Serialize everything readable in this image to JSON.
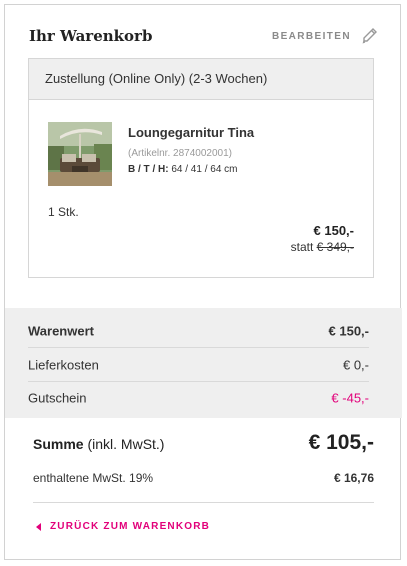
{
  "cart": {
    "title": "Ihr Warenkorb",
    "edit_label": "BEARBEITEN"
  },
  "delivery": {
    "heading": "Zustellung (Online Only) (2-3 Wochen)",
    "item": {
      "name": "Loungegarnitur Tina",
      "article_no": "(Artikelnr. 2874002001)",
      "dim_label": "B / T / H:",
      "dim_value": "64 / 41 / 64 cm",
      "quantity": "1 Stk.",
      "price": "€ 150,-",
      "was_prefix": "statt",
      "was_price": "€ 349,-"
    }
  },
  "summary": {
    "rows": [
      {
        "label": "Warenwert",
        "value": "€ 150,-"
      },
      {
        "label": "Lieferkosten",
        "value": "€ 0,-"
      },
      {
        "label": "Gutschein",
        "value": "€ -45,-"
      }
    ],
    "total_label": "Summe",
    "total_suffix": "(inkl. MwSt.)",
    "total_value": "€ 105,-",
    "tax_label": "enthaltene MwSt. 19%",
    "tax_value": "€ 16,76"
  },
  "back_link": "ZURÜCK ZUM WARENKORB",
  "colors": {
    "accent": "#e2007a",
    "panel": "#efefef"
  },
  "icons": [
    "pencil-icon",
    "back-arrow-icon",
    "product-image"
  ]
}
